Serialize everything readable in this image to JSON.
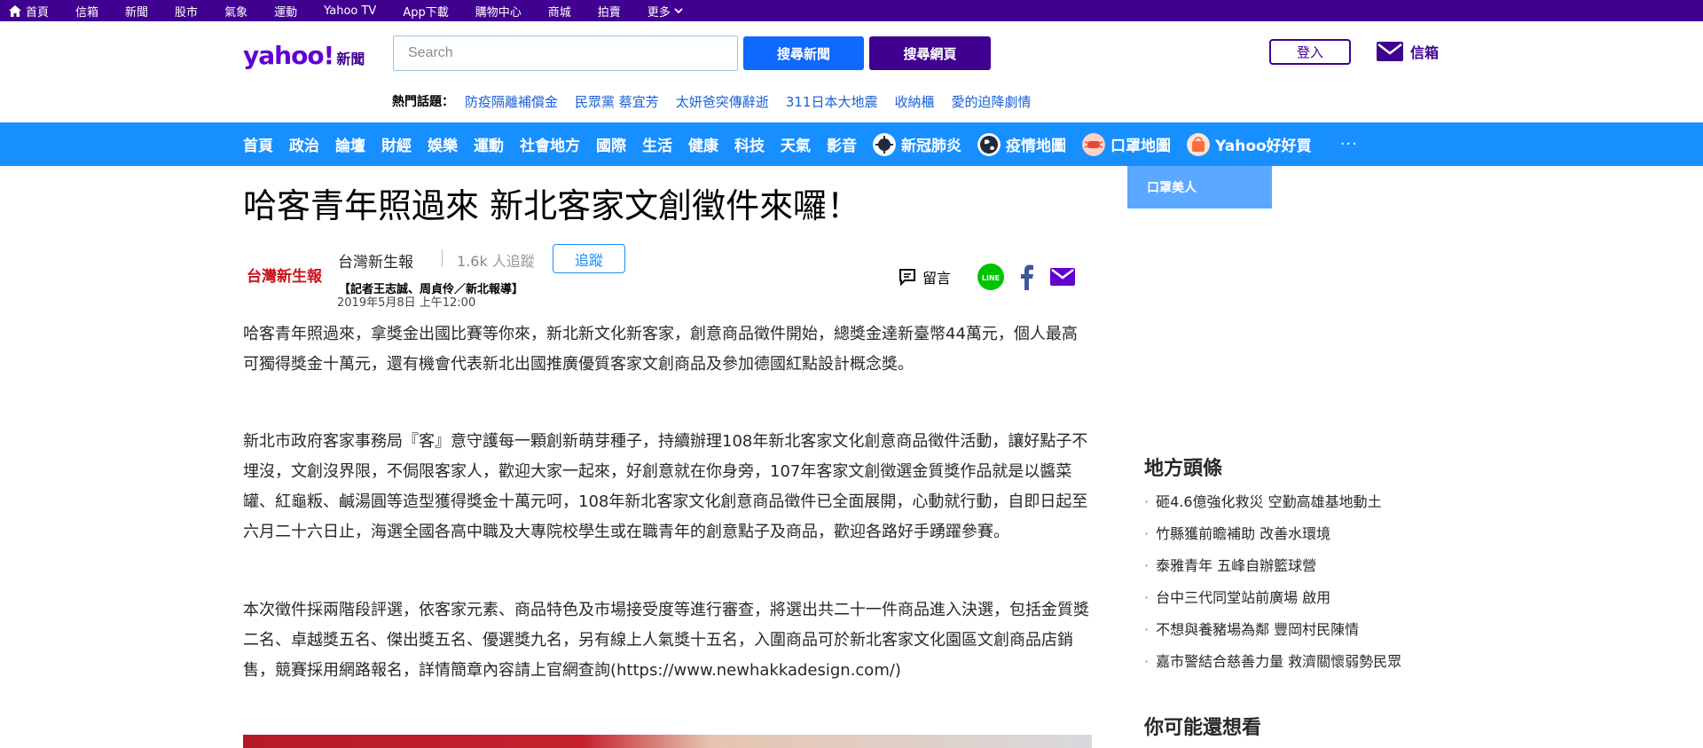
{
  "topbar": {
    "items": [
      "首頁",
      "信箱",
      "新聞",
      "股市",
      "氣象",
      "運動",
      "Yahoo TV",
      "App下載",
      "購物中心",
      "商城",
      "拍賣",
      "更多"
    ]
  },
  "header": {
    "brand": "yahoo!",
    "brand_sub": "新聞",
    "search_placeholder": "Search",
    "search_news_label": "搜尋新聞",
    "search_web_label": "搜尋網頁",
    "login_label": "登入",
    "mail_label": "信箱"
  },
  "hot_topics": {
    "label": "熱門話題：",
    "topics": [
      "防疫隔離補償金",
      "民眾黨 蔡宜芳",
      "太妍爸突傳辭逝",
      "311日本大地震",
      "收納櫃",
      "愛的迫降劇情"
    ]
  },
  "nav": {
    "items": [
      "首頁",
      "政治",
      "論壇",
      "財經",
      "娛樂",
      "運動",
      "社會地方",
      "國際",
      "生活",
      "健康",
      "科技",
      "天氣",
      "影音"
    ],
    "special": [
      {
        "label": "新冠肺炎",
        "icon": "virus-icon"
      },
      {
        "label": "疫情地圖",
        "icon": "globe-icon"
      },
      {
        "label": "口罩地圖",
        "icon": "mask-map-icon"
      },
      {
        "label": "Yahoo好好買",
        "icon": "shopping-bag-icon"
      }
    ],
    "more_label": "···",
    "dropdown_item": "口罩美人"
  },
  "article": {
    "title": "哈客青年照過來 新北客家文創徵件來囉！",
    "provider": "台灣新生報",
    "provider_logo_text": "台灣新生報",
    "followers": "1.6k",
    "followers_suffix": " 人追蹤",
    "follow_label": "追蹤",
    "byline": "【記者王志誠、周貞伶／新北報導】",
    "date": "2019年5月8日 上午12:00",
    "comment_label": "留言",
    "paragraphs": [
      "哈客青年照過來，拿獎金出國比賽等你來，新北新文化新客家，創意商品徵件開始，總獎金達新臺幣44萬元，個人最高可獨得獎金十萬元，還有機會代表新北出國推廣優質客家文創商品及參加德國紅點設計概念獎。",
      "新北市政府客家事務局『客』意守護每一顆創新萌芽種子，持續辦理108年新北客家文化創意商品徵件活動，讓好點子不埋沒，文創沒界限，不侷限客家人，歡迎大家一起來，好創意就在你身旁，107年客家文創徵選金質獎作品就是以醬菜罐、紅龜粄、鹹湯圓等造型獲得獎金十萬元呵，108年新北客家文化創意商品徵件已全面展開，心動就行動，自即日起至六月二十六日止，海選全國各高中職及大專院校學生或在職青年的創意點子及商品，歡迎各路好手踴躍參賽。",
      "本次徵件採兩階段評選，依客家元素、商品特色及市場接受度等進行審查，將選出共二十一件商品進入決選，包括金質獎二名、卓越獎五名、傑出獎五名、優選獎九名，另有線上人氣獎十五名，入圍商品可於新北客家文化園區文創商品店銷售，競賽採用網路報名，詳情簡章內容請上官網查詢(https://www.newhakkadesign.com/)"
    ]
  },
  "rail": {
    "local_title": "地方頭條",
    "local_items": [
      "砸4.6億強化救災 空勤高雄基地動土",
      "竹縣獲前瞻補助 改善水環境",
      "泰雅青年 五峰自辦籃球營",
      "台中三代同堂站前廣場 啟用",
      "不想與養豬場為鄰 豐岡村民陳情",
      "嘉市警結合慈善力量 救濟關懷弱勢民眾"
    ],
    "maybe_title": "你可能還想看"
  },
  "colors": {
    "topbar": "#400090",
    "nav": "#188fff",
    "brand": "#6001d2",
    "search_news": "#0f69ff",
    "link": "#1a5fd6"
  }
}
